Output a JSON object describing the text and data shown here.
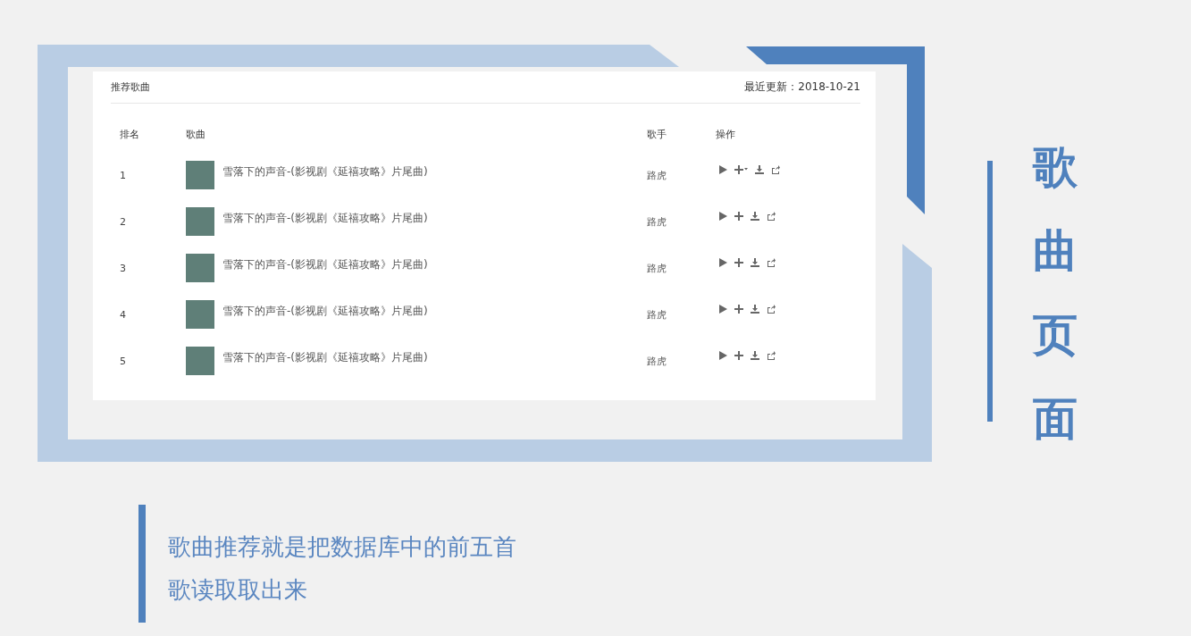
{
  "card": {
    "title": "推荐歌曲",
    "updated": "最近更新：2018-10-21"
  },
  "table": {
    "columns": [
      "排名",
      "歌曲",
      "歌手",
      "操作"
    ],
    "rows": [
      {
        "rank": "1",
        "song": "雪落下的声音-(影视剧《延禧攻略》片尾曲)",
        "singer": "路虎",
        "add_menu": true
      },
      {
        "rank": "2",
        "song": "雪落下的声音-(影视剧《延禧攻略》片尾曲)",
        "singer": "路虎",
        "add_menu": false
      },
      {
        "rank": "3",
        "song": "雪落下的声音-(影视剧《延禧攻略》片尾曲)",
        "singer": "路虎",
        "add_menu": false
      },
      {
        "rank": "4",
        "song": "雪落下的声音-(影视剧《延禧攻略》片尾曲)",
        "singer": "路虎",
        "add_menu": false
      },
      {
        "rank": "5",
        "song": "雪落下的声音-(影视剧《延禧攻略》片尾曲)",
        "singer": "路虎",
        "add_menu": false
      }
    ]
  },
  "side_title": "歌曲页面",
  "caption": "歌曲推荐就是把数据库中的前五首歌读取取出来"
}
